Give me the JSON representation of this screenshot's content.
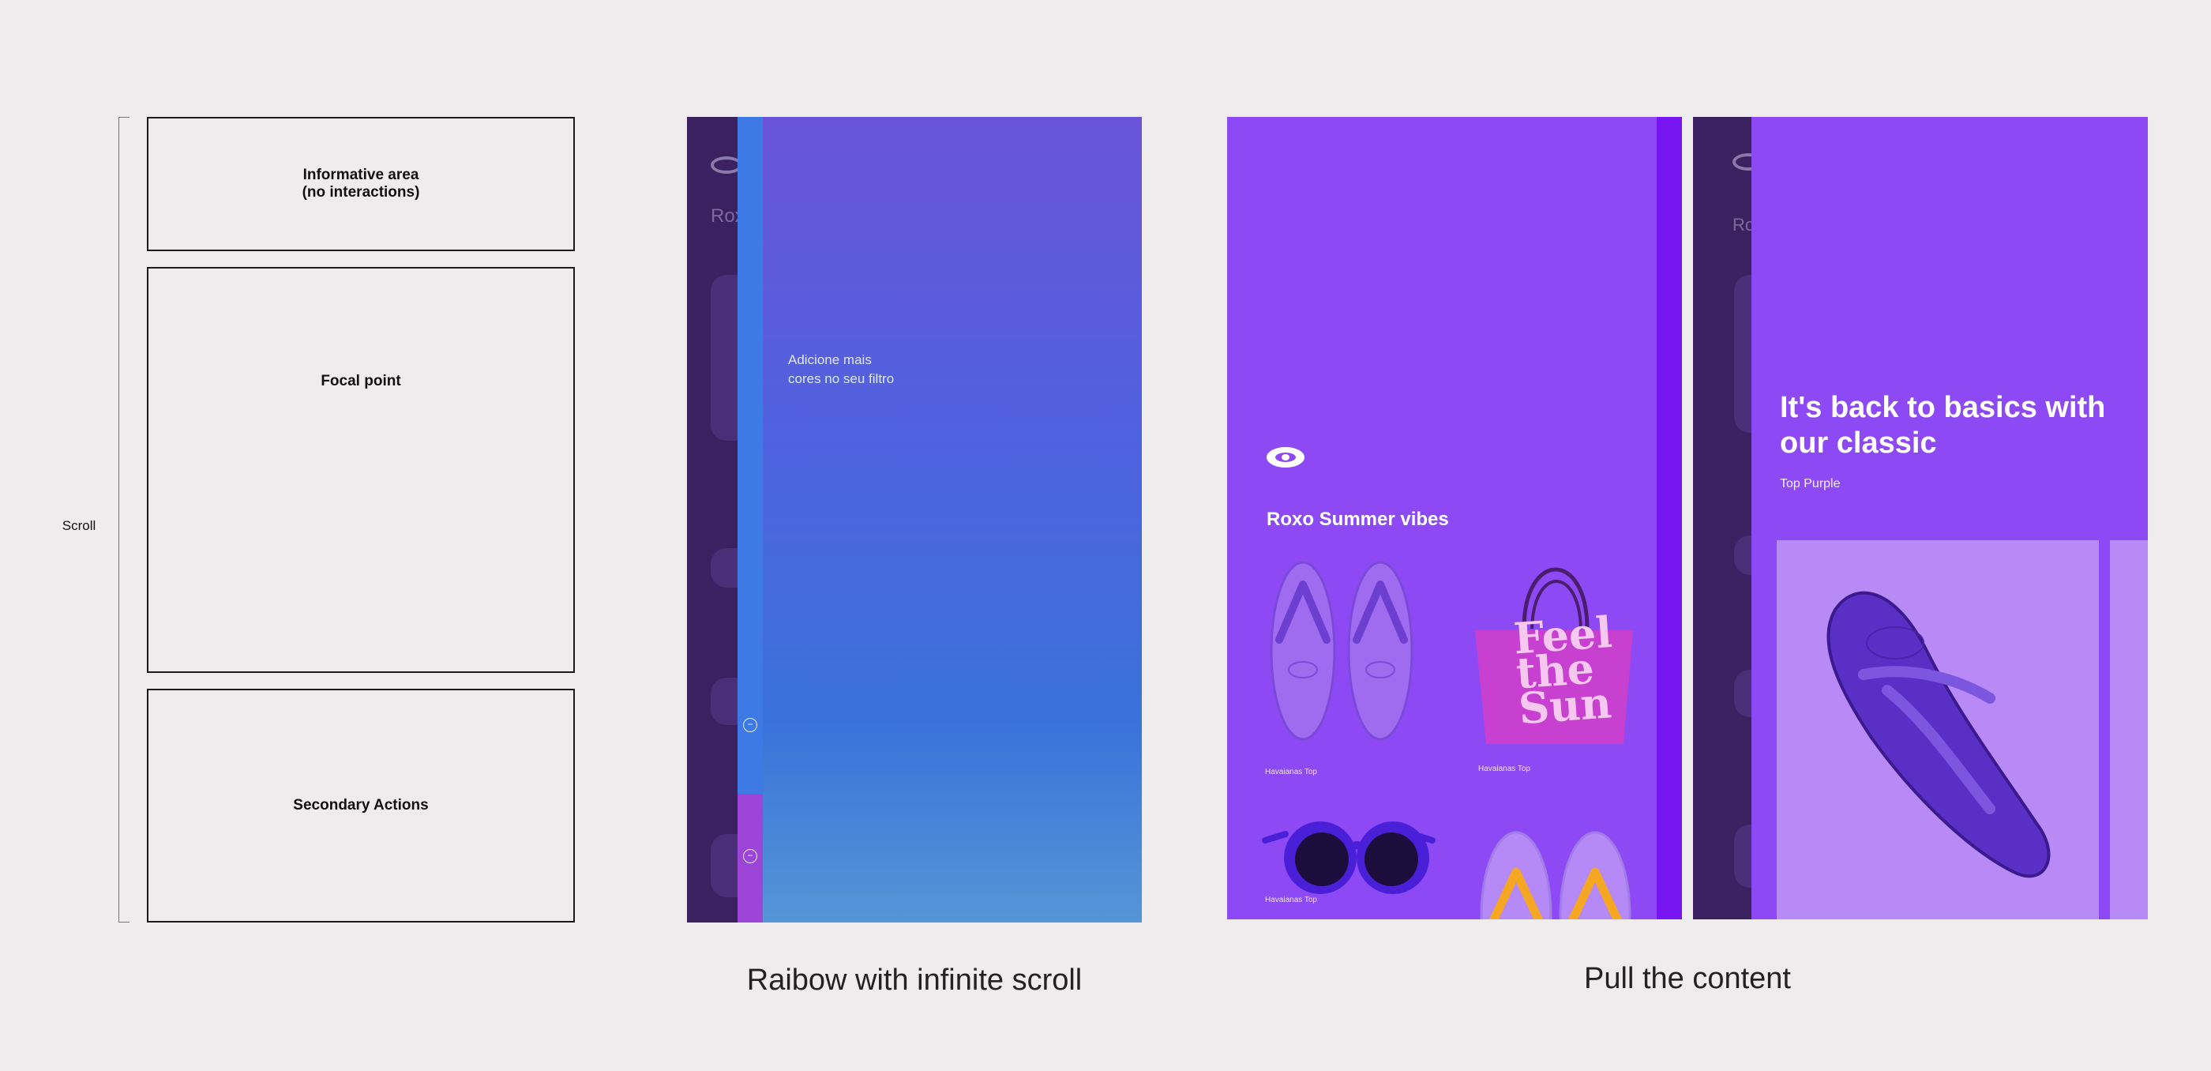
{
  "wireframe": {
    "scroll_label": "Scroll",
    "boxes": {
      "informative": "Informative area\n(no interactions)",
      "focal": "Focal point",
      "secondary": "Secondary Actions"
    }
  },
  "rainbow": {
    "back_title_fragment": "Rox",
    "hint_text": "Adicione mais cores no seu filtro",
    "caption": "Raibow with infinite scroll",
    "icon_glyph": "−"
  },
  "product_list": {
    "title": "Roxo Summer vibes",
    "products": [
      {
        "label": "Havaianas Top"
      },
      {
        "label": "Havaianas Top"
      },
      {
        "label": "Havaianas Top"
      }
    ],
    "bag_print": "Feel the Sun"
  },
  "product_detail": {
    "back_title_fragment": "Ro",
    "headline": "It's back to basics with our classic",
    "subtitle": "Top Purple",
    "caption": "Pull the content"
  },
  "colors": {
    "background": "#efecee",
    "purple": "#8d4af4",
    "deep_purple": "#3b2160",
    "edge_purple": "#7816f2",
    "card_lilac": "#b88af6"
  }
}
